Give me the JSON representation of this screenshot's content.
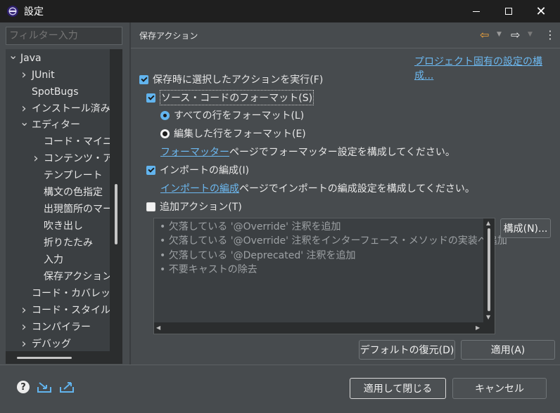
{
  "window": {
    "title": "設定"
  },
  "filter": {
    "placeholder": "フィルター入力"
  },
  "tree": {
    "items": [
      {
        "label": "Java",
        "chevron": "v"
      },
      {
        "label": "JUnit",
        "chevron": ">"
      },
      {
        "label": "SpotBugs",
        "chevron": ""
      },
      {
        "label": "インストール済みの",
        "chevron": ">"
      },
      {
        "label": "エディター",
        "chevron": "v"
      },
      {
        "label": "コード・マイニング",
        "chevron": ""
      },
      {
        "label": "コンテンツ・アシス",
        "chevron": ">"
      },
      {
        "label": "テンプレート",
        "chevron": ""
      },
      {
        "label": "構文の色指定",
        "chevron": ""
      },
      {
        "label": "出現箇所のマー",
        "chevron": ""
      },
      {
        "label": "吹き出し",
        "chevron": ""
      },
      {
        "label": "折りたたみ",
        "chevron": ""
      },
      {
        "label": "入力",
        "chevron": ""
      },
      {
        "label": "保存アクション",
        "chevron": ""
      },
      {
        "label": "コード・カバレッジ",
        "chevron": ""
      },
      {
        "label": "コード・スタイル",
        "chevron": ">"
      },
      {
        "label": "コンパイラー",
        "chevron": ">"
      },
      {
        "label": "デバッグ",
        "chevron": ">"
      }
    ]
  },
  "page": {
    "title": "保存アクション",
    "project_link": "プロジェクト固有の設定の構成...",
    "perform_on_save": "保存時に選択したアクションを実行(F)",
    "format_source": "ソース・コードのフォーマット(S)",
    "format_all": "すべての行をフォーマット(L)",
    "format_edited": "編集した行をフォーマット(E)",
    "formatter_link": "フォーマッター",
    "formatter_text": "ページでフォーマッター設定を構成してください。",
    "organize_imports": "インポートの編成(I)",
    "imports_link": "インポートの編成",
    "imports_text": "ページでインポートの編成設定を構成してください。",
    "additional_actions": "追加アクション(T)",
    "actions": [
      "欠落している '@Override' 注釈を追加",
      "欠落している '@Override' 注釈をインターフェース・メソッドの実装へ追加",
      "欠落している '@Deprecated' 注釈を追加",
      "不要キャストの除去"
    ],
    "configure_button": "構成(N)...",
    "restore_defaults": "デフォルトの復元(D)",
    "apply": "適用(A)"
  },
  "footer": {
    "apply_close": "適用して閉じる",
    "cancel": "キャンセル"
  },
  "colors": {
    "accent": "#62b4ee",
    "link": "#6cb8f0",
    "background": "#474b4e",
    "titlebar": "#1f1f1f"
  }
}
